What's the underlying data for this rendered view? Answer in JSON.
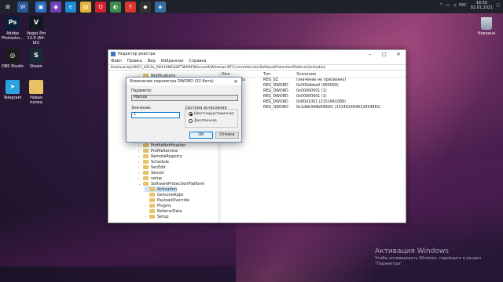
{
  "taskbar": {
    "icons": [
      {
        "name": "windows-icon",
        "color": "#20222b",
        "glyph": "⊞"
      },
      {
        "name": "word-icon",
        "color": "#2b5797",
        "glyph": "W"
      },
      {
        "name": "terminal-icon",
        "color": "#2d6fc0",
        "glyph": "▣"
      },
      {
        "name": "tor-icon",
        "color": "#6f3fb5",
        "glyph": "◉"
      },
      {
        "name": "edge-icon",
        "color": "#1f8ad6",
        "glyph": "e"
      },
      {
        "name": "explorer-icon",
        "color": "#e2b23a",
        "glyph": "▤"
      },
      {
        "name": "opera-icon",
        "color": "#d2202f",
        "glyph": "O"
      },
      {
        "name": "chrome-icon",
        "color": "#3a8e47",
        "glyph": "◐"
      },
      {
        "name": "yandex-icon",
        "color": "#d8362e",
        "glyph": "Y"
      },
      {
        "name": "unity-icon",
        "color": "#333333",
        "glyph": "◆"
      },
      {
        "name": "python-icon",
        "color": "#356f9f",
        "glyph": "◈"
      }
    ],
    "tray": {
      "lang": "РУС",
      "time": "18:55",
      "date": "02.01.2021"
    }
  },
  "desktop": {
    "icons": [
      {
        "name": "photoshop-icon",
        "label": "Adobe Photosho...",
        "color": "#0b1e3a",
        "glyph": "Ps"
      },
      {
        "name": "vegas-icon",
        "label": "Vegas Pro 13.0 (64-bit)",
        "color": "#11181f",
        "glyph": "V"
      },
      {
        "name": "obs-icon",
        "label": "OBS Studio",
        "color": "#1c1c1c",
        "glyph": "◎"
      },
      {
        "name": "steam-icon",
        "label": "Steam",
        "color": "#1b2838",
        "glyph": "S"
      },
      {
        "name": "telegram-icon",
        "label": "Telegram",
        "color": "#2aa3df",
        "glyph": "➤"
      },
      {
        "name": "folder-icon",
        "label": "Новая папка",
        "color": "#e8c363",
        "glyph": ""
      }
    ],
    "trash_label": "Корзина"
  },
  "regedit": {
    "title": "Редактор реестра",
    "menu": [
      "Файл",
      "Правка",
      "Вид",
      "Избранное",
      "Справка"
    ],
    "address": "Компьютер\\HKEY_LOCAL_MACHINE\\SOFTWARE\\Microsoft\\Windows NT\\CurrentVersion\\SoftwareProtectionPlatform\\Activation",
    "tree": [
      {
        "label": "Notifications",
        "indent": 1,
        "chev": ">",
        "selected": false
      },
      {
        "label": "ProfileNotification",
        "indent": 1,
        "chev": ">",
        "selected": false
      },
      {
        "label": "ProfileService",
        "indent": 1,
        "chev": ">",
        "selected": false
      },
      {
        "label": "RemoteRegistry",
        "indent": 1,
        "chev": ">",
        "selected": false
      },
      {
        "label": "Schedule",
        "indent": 1,
        "chev": ">",
        "selected": false
      },
      {
        "label": "SecEdit",
        "indent": 1,
        "chev": ">",
        "selected": false
      },
      {
        "label": "Sensor",
        "indent": 1,
        "chev": ">",
        "selected": false
      },
      {
        "label": "setup",
        "indent": 1,
        "chev": ">",
        "selected": false
      },
      {
        "label": "SoftwareProtectionPlatform",
        "indent": 1,
        "chev": "v",
        "selected": false
      },
      {
        "label": "Activation",
        "indent": 2,
        "chev": "",
        "selected": true
      },
      {
        "label": "GenuineApps",
        "indent": 2,
        "chev": "",
        "selected": false
      },
      {
        "label": "PayloadOverride",
        "indent": 2,
        "chev": "",
        "selected": false
      },
      {
        "label": "Plugins",
        "indent": 2,
        "chev": ">",
        "selected": false
      },
      {
        "label": "ReferralData",
        "indent": 2,
        "chev": "",
        "selected": false
      },
      {
        "label": "Setup",
        "indent": 2,
        "chev": ">",
        "selected": false
      }
    ],
    "columns": {
      "name": "Имя",
      "type": "Тип",
      "value": "Значение"
    },
    "values": [
      {
        "name": "умолчанию)",
        "type": "REG_SZ",
        "value": "(значение не присвоено)"
      },
      {
        "name": "Interval",
        "type": "REG_DWORD",
        "value": "0x000dbba0 (900000)"
      },
      {
        "name": "",
        "type": "REG_DWORD",
        "value": "0x00000001 (1)"
      },
      {
        "name": "ctionDisa...",
        "type": "REG_DWORD",
        "value": "0x00000001 (1)"
      },
      {
        "name": "Activatio...",
        "type": "REG_DWORD",
        "value": "0x80d1001 (2151641089)"
      },
      {
        "name": "Activatio...",
        "type": "REG_QWORD",
        "value": "0x1d6b448b9f0b61 (132491464622934881)"
      }
    ]
  },
  "dialog": {
    "title": "Изменение параметра DWORD (32 бита)",
    "param_label": "Параметр:",
    "param_value": "Manual",
    "value_label": "Значение:",
    "value_value": "1",
    "radix_label": "Система исчисления",
    "radix_hex": "Шестнадцатеричная",
    "radix_dec": "Десятичная",
    "ok": "ОК",
    "cancel": "Отмена"
  },
  "watermark": {
    "title": "Активация Windows",
    "line1": "Чтобы активировать Windows, перейдите в раздел",
    "line2": "\"Параметры\"."
  }
}
